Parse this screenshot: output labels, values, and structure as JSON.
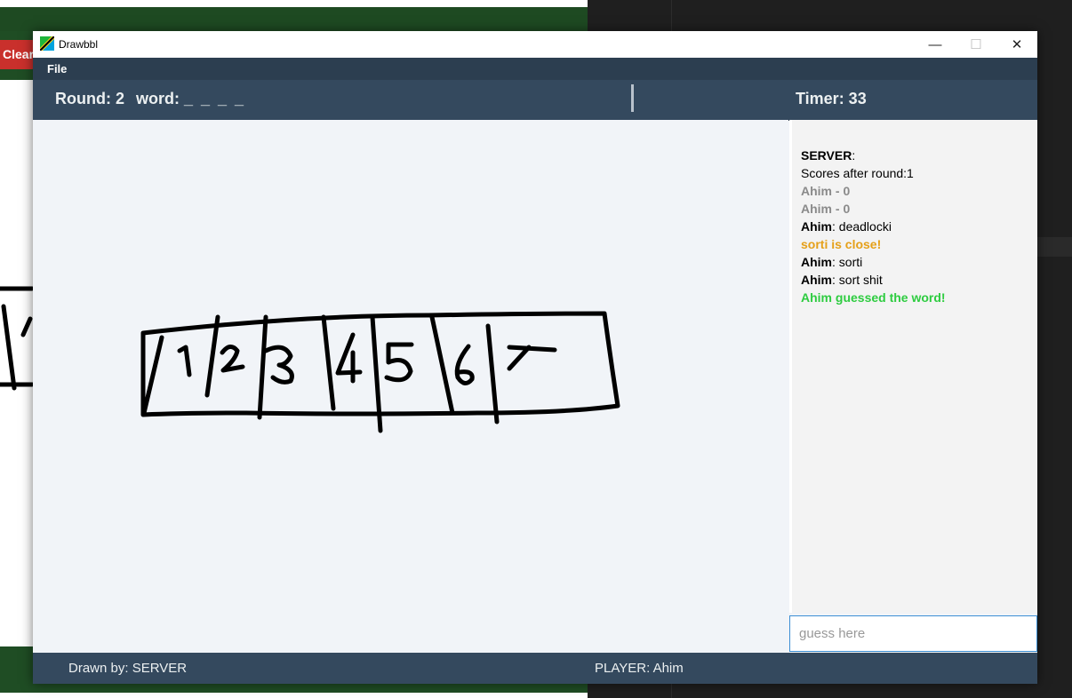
{
  "background_window": {
    "clear_button_label": "Clear"
  },
  "window": {
    "title": "Drawbbl",
    "controls": {
      "minimize": "—",
      "maximize": "☐",
      "close": "✕"
    }
  },
  "menu": {
    "file_label": "File"
  },
  "header": {
    "round_text": "Round: 2",
    "word_label": "word:",
    "word_value": "_ _ _ _",
    "timer_text": "Timer: 33"
  },
  "chat": {
    "messages": [
      {
        "sender": "SERVER",
        "text": ":"
      },
      {
        "text": "Scores after round:1"
      },
      {
        "text": "Ahim - 0"
      },
      {
        "text": "Ahim - 0"
      },
      {
        "sender": "Ahim",
        "text": ": deadlocki"
      },
      {
        "text": "sorti is close!"
      },
      {
        "sender": "Ahim",
        "text": ": sorti"
      },
      {
        "sender": "Ahim",
        "text": ": sort shit"
      },
      {
        "text": "Ahim guessed the word!"
      }
    ]
  },
  "guess_input": {
    "placeholder": "guess here",
    "value": ""
  },
  "status": {
    "drawn_by": "Drawn by: SERVER",
    "player": "PLAYER: Ahim"
  },
  "drawing": {
    "digits": [
      "1",
      "2",
      "3",
      "4",
      "5",
      "6",
      "7"
    ]
  },
  "colors": {
    "header_bg": "#34495e",
    "menu_bg": "#2c3e50",
    "canvas_bg": "#f1f4f8",
    "close_hint": "#e5a019",
    "correct_guess": "#2ecc40",
    "score_text": "#8a8a8a"
  }
}
